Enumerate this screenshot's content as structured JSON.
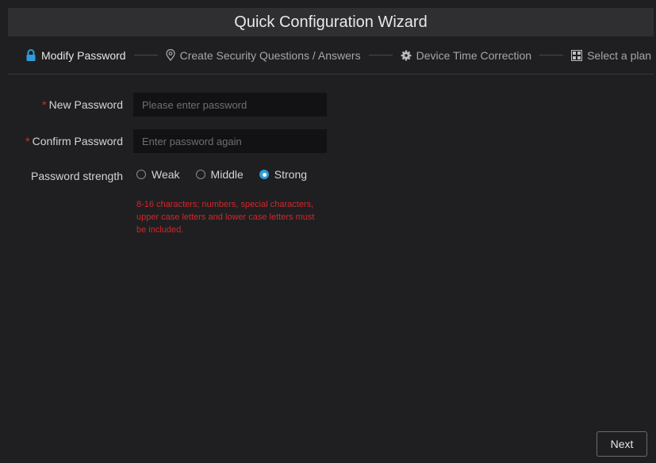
{
  "title": "Quick Configuration Wizard",
  "steps": [
    {
      "label": "Modify Password",
      "icon": "lock-icon",
      "active": true
    },
    {
      "label": "Create Security Questions / Answers",
      "icon": "location-pin-icon",
      "active": false
    },
    {
      "label": "Device Time Correction",
      "icon": "gear-icon",
      "active": false
    },
    {
      "label": "Select a plan",
      "icon": "grid-plan-icon",
      "active": false
    }
  ],
  "form": {
    "required_mark": "*",
    "new_password": {
      "label": "New Password",
      "value": "",
      "placeholder": "Please enter password"
    },
    "confirm_password": {
      "label": "Confirm Password",
      "value": "",
      "placeholder": "Enter password again"
    },
    "strength": {
      "label": "Password strength",
      "options": [
        "Weak",
        "Middle",
        "Strong"
      ],
      "selected": "Strong"
    },
    "hint": "8-16 characters; numbers, special characters, upper case letters and lower case letters must be included."
  },
  "next_label": "Next",
  "colors": {
    "accent": "#2d9cdb",
    "error": "#d3262a",
    "background": "#1f1f21",
    "titlebar": "#2f2f31"
  }
}
